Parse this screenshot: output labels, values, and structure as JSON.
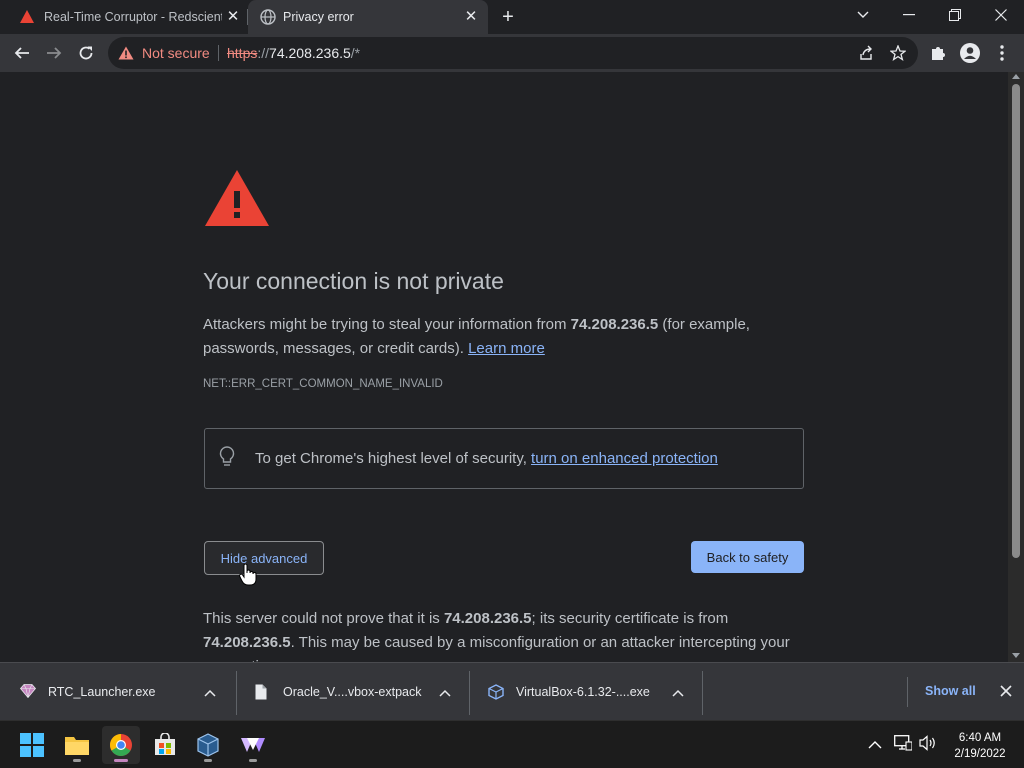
{
  "browser": {
    "tabs": [
      {
        "title": "Real-Time Corruptor - Redscientist",
        "icon": "warning-triangle-icon",
        "active": false
      },
      {
        "title": "Privacy error",
        "icon": "globe-icon",
        "active": true
      }
    ],
    "address_bar": {
      "security_label": "Not secure",
      "url_scheme": "https",
      "url_separator": "://",
      "url_host": "74.208.236.5",
      "url_path": "/*"
    }
  },
  "page": {
    "heading": "Your connection is not private",
    "intro_before": "Attackers might be trying to steal your information from ",
    "intro_host": "74.208.236.5",
    "intro_after": " (for example, passwords, messages, or credit cards). ",
    "learn_more": "Learn more",
    "error_code": "NET::ERR_CERT_COMMON_NAME_INVALID",
    "protection_text": "To get Chrome's highest level of security, ",
    "protection_link": "turn on enhanced protection",
    "hide_advanced": "Hide advanced",
    "back_to_safety": "Back to safety",
    "advanced_before": "This server could not prove that it is ",
    "advanced_host1": "74.208.236.5",
    "advanced_mid": "; its security certificate is from ",
    "advanced_host2": "74.208.236.5",
    "advanced_after": ". This may be caused by a misconfiguration or an attacker intercepting your connection."
  },
  "downloads": {
    "items": [
      {
        "name": "RTC_Launcher.exe",
        "icon": "gem-icon"
      },
      {
        "name": "Oracle_V....vbox-extpack",
        "icon": "file-icon"
      },
      {
        "name": "VirtualBox-6.1.32-....exe",
        "icon": "virtualbox-icon"
      }
    ],
    "show_all": "Show all"
  },
  "taskbar": {
    "time": "6:40 AM",
    "date": "2/19/2022",
    "apps": [
      "start-icon",
      "file-explorer-icon",
      "chrome-icon",
      "store-icon",
      "virtualbox-icon",
      "rtc-icon"
    ]
  },
  "colors": {
    "link": "#8ab4f8",
    "warning_red": "#ea4335",
    "not_secure": "#f28b82"
  }
}
